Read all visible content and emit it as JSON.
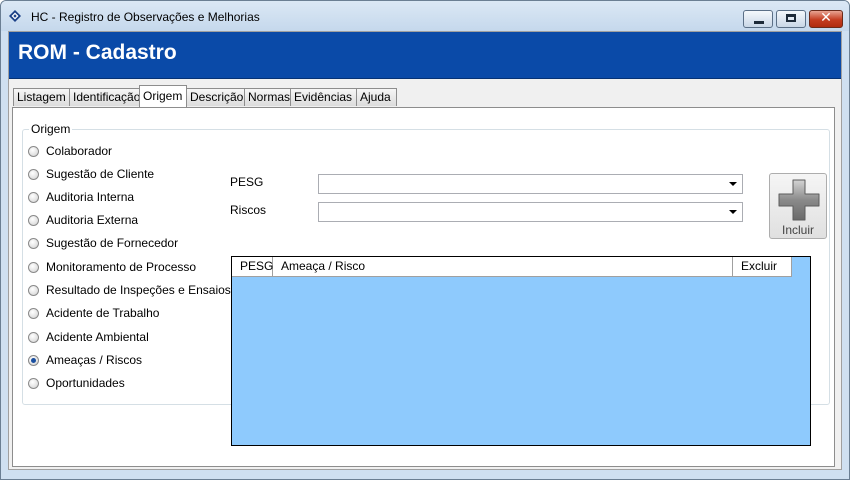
{
  "window": {
    "title": "HC - Registro de Observações e Melhorias",
    "controls": {
      "close_symbol": "✕"
    }
  },
  "header": {
    "title": "ROM - Cadastro"
  },
  "tabs": [
    {
      "label": "Listagem"
    },
    {
      "label": "Identificação"
    },
    {
      "label": "Origem",
      "active": true
    },
    {
      "label": "Descrição"
    },
    {
      "label": "Normas"
    },
    {
      "label": "Evidências"
    },
    {
      "label": "Ajuda"
    }
  ],
  "origem": {
    "group_caption": "Origem",
    "options": [
      {
        "label": "Colaborador",
        "checked": false
      },
      {
        "label": "Sugestão de Cliente",
        "checked": false
      },
      {
        "label": "Auditoria Interna",
        "checked": false
      },
      {
        "label": "Auditoria Externa",
        "checked": false
      },
      {
        "label": "Sugestão de Fornecedor",
        "checked": false
      },
      {
        "label": "Monitoramento de Processo",
        "checked": false
      },
      {
        "label": "Resultado de Inspeções e Ensaios",
        "checked": false
      },
      {
        "label": "Acidente de Trabalho",
        "checked": false
      },
      {
        "label": "Acidente Ambiental",
        "checked": false
      },
      {
        "label": "Ameaças / Riscos",
        "checked": true
      },
      {
        "label": "Oportunidades",
        "checked": false
      }
    ],
    "pesg": {
      "label": "PESG",
      "value": ""
    },
    "riscos": {
      "label": "Riscos",
      "value": ""
    },
    "incluir_button": {
      "label": "Incluir",
      "icon": "plus-icon"
    },
    "grid": {
      "columns": [
        "PESG",
        "Ameaça / Risco",
        "Excluir"
      ],
      "rows": []
    }
  },
  "colors": {
    "header_bg": "#0a4aa8",
    "grid_bg": "#8ecafd",
    "window_frame": "#cfe0f1"
  }
}
